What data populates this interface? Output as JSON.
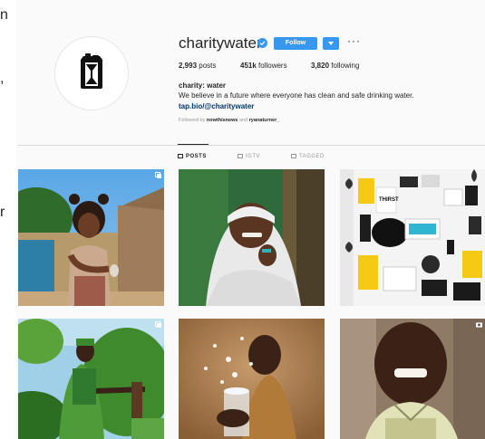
{
  "left_strip": {
    "chars": [
      "n",
      ",",
      "r"
    ]
  },
  "profile": {
    "username": "charitywater",
    "follow_label": "Follow",
    "more_label": "···",
    "stats": {
      "posts_value": "2,993",
      "posts_label": "posts",
      "followers_value": "451k",
      "followers_label": "followers",
      "following_value": "3,820",
      "following_label": "following"
    },
    "full_name": "charity: water",
    "bio": "We believe in a future where everyone has clean and safe drinking water.",
    "link": "tap.bio/@charitywater",
    "followed_by": {
      "prefix": "Followed by",
      "user1": "nowthisnews",
      "and": "and",
      "user2": "ryanaturner_"
    }
  },
  "tabs": [
    {
      "label": "POSTS",
      "active": true
    },
    {
      "label": "IGTV",
      "active": false
    },
    {
      "label": "TAGGED",
      "active": false
    }
  ],
  "colors": {
    "accent": "#3897f0",
    "jerrycan": "#ffc907",
    "link": "#003569"
  },
  "posts": [
    {
      "icon": "multiple-posts-icon"
    },
    {
      "icon": "none"
    },
    {
      "icon": "none"
    },
    {
      "icon": "multiple-posts-icon"
    },
    {
      "icon": "none"
    },
    {
      "icon": "video-icon"
    }
  ]
}
